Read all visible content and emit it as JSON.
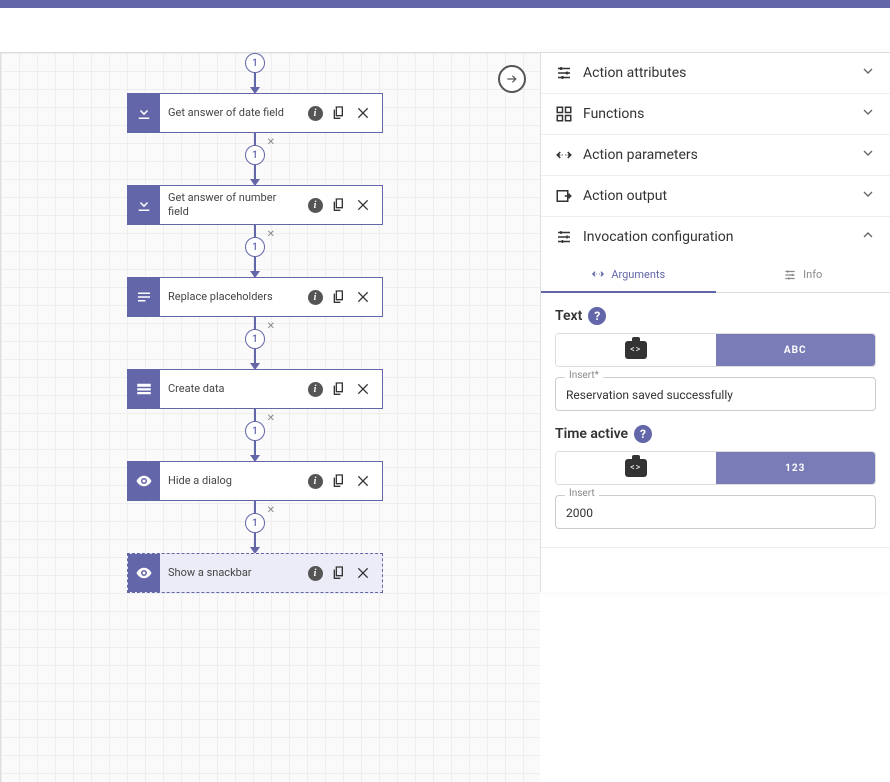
{
  "flow": {
    "nodes": [
      {
        "label": "Get answer of date field",
        "icon": "download",
        "counter": "1",
        "showX": false
      },
      {
        "label": "Get answer of number field",
        "icon": "download",
        "counter": "1",
        "showX": true
      },
      {
        "label": "Replace placeholders",
        "icon": "lines",
        "counter": "1",
        "showX": true
      },
      {
        "label": "Create data",
        "icon": "table",
        "counter": "1",
        "showX": true
      },
      {
        "label": "Hide a dialog",
        "icon": "eye",
        "counter": "1",
        "showX": true
      },
      {
        "label": "Show a snackbar",
        "icon": "eye",
        "counter": "1",
        "showX": true,
        "selected": true
      }
    ]
  },
  "panel": {
    "sections": [
      {
        "title": "Action attributes",
        "icon": "sliders",
        "expanded": false
      },
      {
        "title": "Functions",
        "icon": "grid",
        "expanded": false
      },
      {
        "title": "Action parameters",
        "icon": "params",
        "expanded": false
      },
      {
        "title": "Action output",
        "icon": "output",
        "expanded": false
      },
      {
        "title": "Invocation configuration",
        "icon": "config",
        "expanded": true
      }
    ],
    "tabs": {
      "arguments": "Arguments",
      "info": "Info"
    },
    "form": {
      "text": {
        "label": "Text",
        "toggleRight": "ABC",
        "legend": "Insert*",
        "value": "Reservation saved successfully"
      },
      "time": {
        "label": "Time active",
        "toggleRight": "123",
        "legend": "Insert",
        "value": "2000"
      }
    }
  }
}
